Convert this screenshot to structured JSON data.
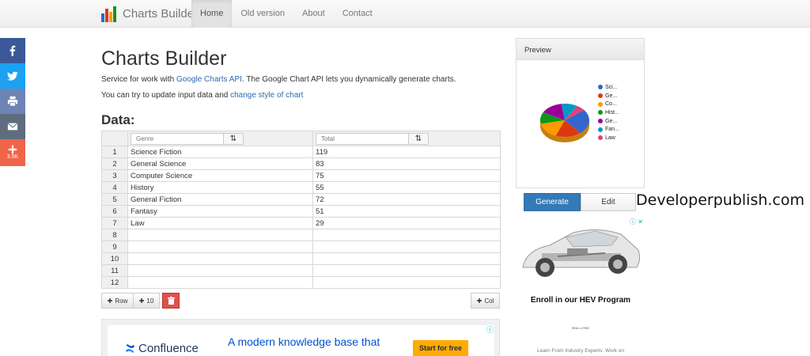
{
  "nav": {
    "brand": "Charts Builder",
    "items": [
      {
        "label": "Home",
        "active": true
      },
      {
        "label": "Old version",
        "active": false
      },
      {
        "label": "About",
        "active": false
      },
      {
        "label": "Contact",
        "active": false
      }
    ]
  },
  "share": {
    "buttons": [
      {
        "icon": "facebook-icon",
        "color": "#3b5998"
      },
      {
        "icon": "twitter-icon",
        "color": "#1da1f2"
      },
      {
        "icon": "print-icon",
        "color": "#6d84b4"
      },
      {
        "icon": "email-icon",
        "color": "#5d6d7e"
      },
      {
        "icon": "plus-icon",
        "color": "#f0654a"
      }
    ],
    "count": "3.5K"
  },
  "main": {
    "title": "Charts Builder",
    "desc1_pre": "Service for work with ",
    "desc1_link": "Google Charts API",
    "desc1_post": ". The Google Chart API lets you dynamically generate charts.",
    "desc2_pre": "You can try to update input data and ",
    "desc2_link": "change style of chart",
    "data_heading": "Data:"
  },
  "grid": {
    "columns": [
      {
        "placeholder": "Genre"
      },
      {
        "placeholder": "Total"
      }
    ],
    "rows": [
      {
        "num": "1",
        "genre": "Science Fiction",
        "total": "119"
      },
      {
        "num": "2",
        "genre": "General Science",
        "total": "83"
      },
      {
        "num": "3",
        "genre": "Computer Science",
        "total": "75"
      },
      {
        "num": "4",
        "genre": "History",
        "total": "55"
      },
      {
        "num": "5",
        "genre": "General Fiction",
        "total": "72"
      },
      {
        "num": "6",
        "genre": "Fantasy",
        "total": "51"
      },
      {
        "num": "7",
        "genre": "Law",
        "total": "29"
      },
      {
        "num": "8",
        "genre": "",
        "total": ""
      },
      {
        "num": "9",
        "genre": "",
        "total": ""
      },
      {
        "num": "10",
        "genre": "",
        "total": ""
      },
      {
        "num": "11",
        "genre": "",
        "total": ""
      },
      {
        "num": "12",
        "genre": "",
        "total": ""
      }
    ],
    "buttons": {
      "row": "Row",
      "ten": "10",
      "col": "Col"
    }
  },
  "preview": {
    "title": "Preview",
    "legend": [
      {
        "label": "Sci...",
        "color": "#3366cc"
      },
      {
        "label": "Ge...",
        "color": "#dc3912"
      },
      {
        "label": "Co...",
        "color": "#ff9900"
      },
      {
        "label": "Hist...",
        "color": "#109618"
      },
      {
        "label": "Ge...",
        "color": "#990099"
      },
      {
        "label": "Fan...",
        "color": "#0099c6"
      },
      {
        "label": "Law",
        "color": "#dd4477"
      }
    ],
    "generate_label": "Generate",
    "edit_label": "Edit"
  },
  "watermark": "Developerpublish.com",
  "ad_bottom": {
    "brand": "Confluence",
    "headline": "A modern knowledge base that",
    "cta": "Start for free"
  },
  "ad_right": {
    "title": "Enroll in our HEV Program",
    "small": "SKILL-LYNC",
    "foot": "Learn From Industry Experts. Work on"
  }
}
